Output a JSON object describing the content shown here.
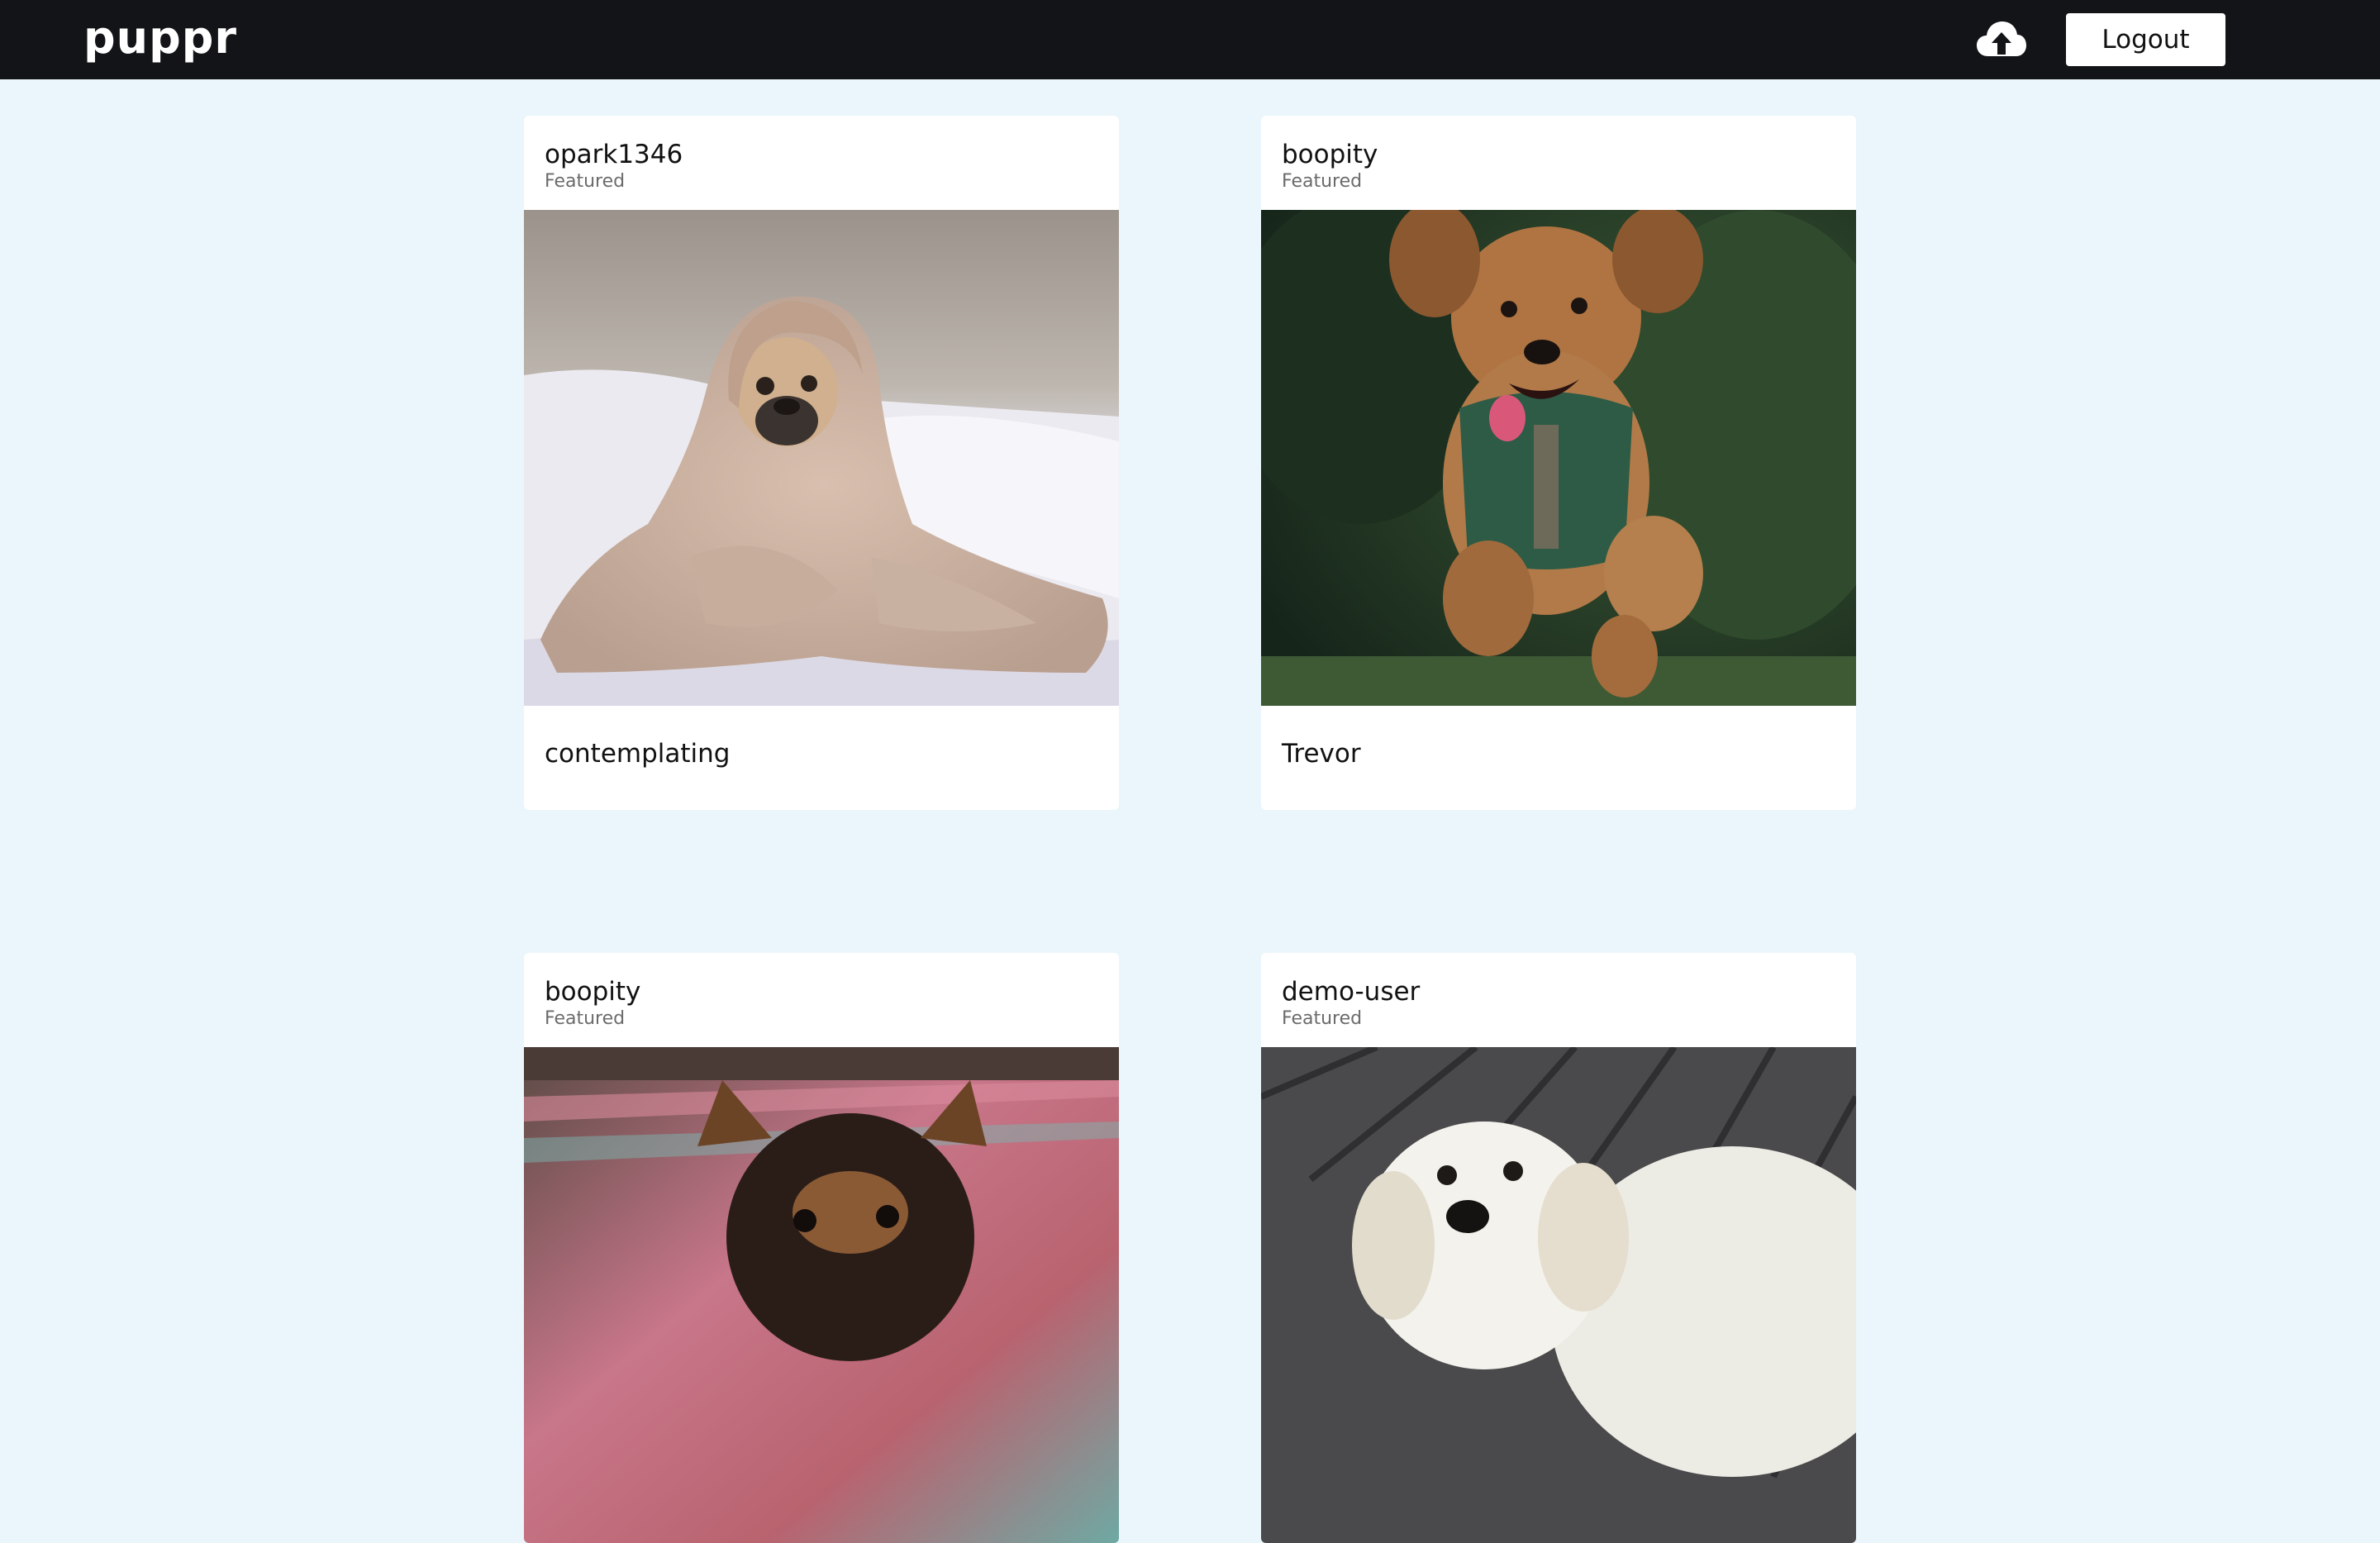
{
  "app": {
    "logo": "puppr",
    "logout_label": "Logout",
    "upload_icon": "cloud-upload-icon"
  },
  "posts": [
    {
      "username": "opark1346",
      "tag": "Featured",
      "caption": "contemplating"
    },
    {
      "username": "boopity",
      "tag": "Featured",
      "caption": "Trevor"
    },
    {
      "username": "boopity",
      "tag": "Featured",
      "caption": ""
    },
    {
      "username": "demo-user",
      "tag": "Featured",
      "caption": ""
    }
  ],
  "colors": {
    "navbar": "#131417",
    "page_background": "#eaf6fb",
    "card": "#ffffff"
  }
}
